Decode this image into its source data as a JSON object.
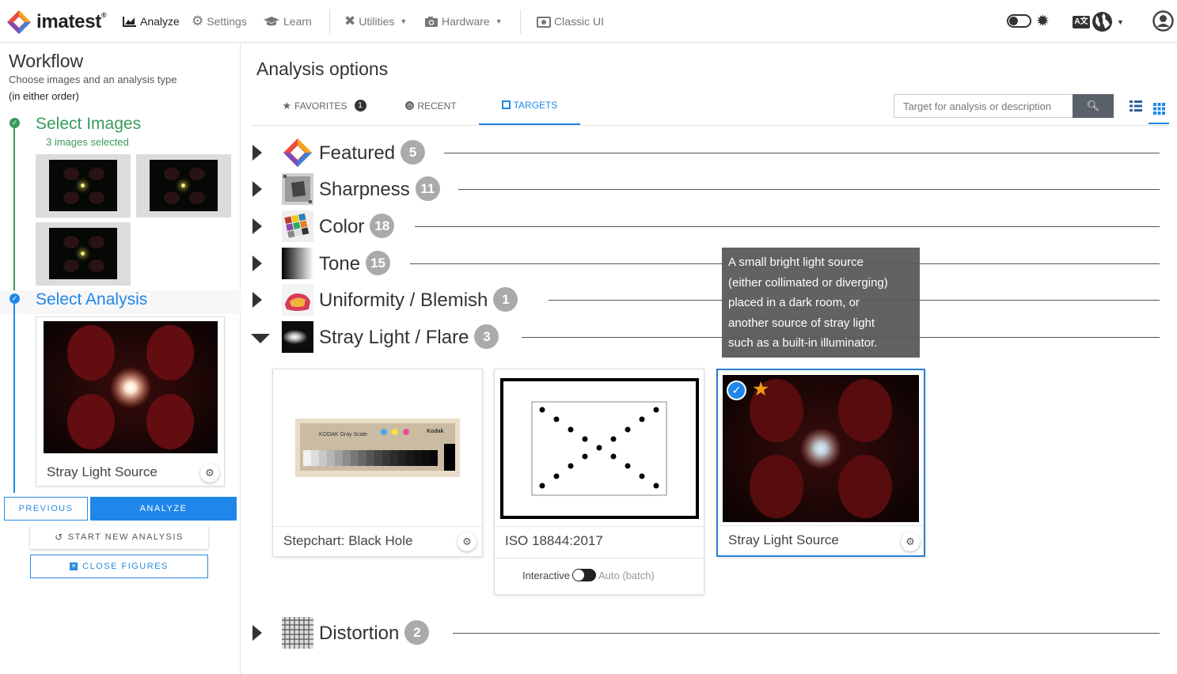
{
  "app": {
    "logo_text": "imatest",
    "logo_reg": "®"
  },
  "nav": {
    "analyze": "Analyze",
    "settings": "Settings",
    "learn": "Learn",
    "utilities": "Utilities",
    "hardware": "Hardware",
    "classic_ui": "Classic UI"
  },
  "workflow": {
    "title": "Workflow",
    "subtitle": "Choose images and an analysis type",
    "subtitle2": "(in either order)",
    "step1_title": "Select Images",
    "step1_sub": "3 images selected",
    "step2_title": "Select Analysis",
    "selected_analysis": "Stray Light Source",
    "btn_previous": "PREVIOUS",
    "btn_analyze": "ANALYZE",
    "btn_new": "START NEW ANALYSIS",
    "btn_close": "CLOSE FIGURES"
  },
  "main": {
    "title": "Analysis options",
    "tabs": [
      {
        "label": "FAVORITES",
        "badge": "1"
      },
      {
        "label": "RECENT"
      },
      {
        "label": "TARGETS"
      }
    ],
    "search_placeholder": "Target for analysis or description"
  },
  "categories": [
    {
      "name": "Featured",
      "count": "5",
      "expanded": false
    },
    {
      "name": "Sharpness",
      "count": "11",
      "expanded": false
    },
    {
      "name": "Color",
      "count": "18",
      "expanded": false
    },
    {
      "name": "Tone",
      "count": "15",
      "expanded": false
    },
    {
      "name": "Uniformity / Blemish",
      "count": "1",
      "expanded": false
    },
    {
      "name": "Stray Light / Flare",
      "count": "3",
      "expanded": true
    },
    {
      "name": "Distortion",
      "count": "2",
      "expanded": false
    }
  ],
  "tooltip": {
    "lines": [
      "A small bright light source",
      "(either collimated or diverging)",
      "placed in a dark room, or",
      "another source of stray light",
      "such as a built-in illuminator."
    ]
  },
  "target_cards": [
    {
      "label": "Stepchart: Black Hole",
      "chart_caption": "KODAK Gray Scale",
      "brand": "Kodak",
      "selected": false
    },
    {
      "label": "ISO 18844:2017",
      "mode_interactive": "Interactive",
      "mode_auto": "Auto (batch)",
      "selected": false
    },
    {
      "label": "Stray Light Source",
      "selected": true,
      "favorite": true
    }
  ],
  "colors": {
    "accent": "#1f87ea",
    "success": "#3a9a5b",
    "badge": "#aaaaaa",
    "favorite": "#f39c12"
  }
}
